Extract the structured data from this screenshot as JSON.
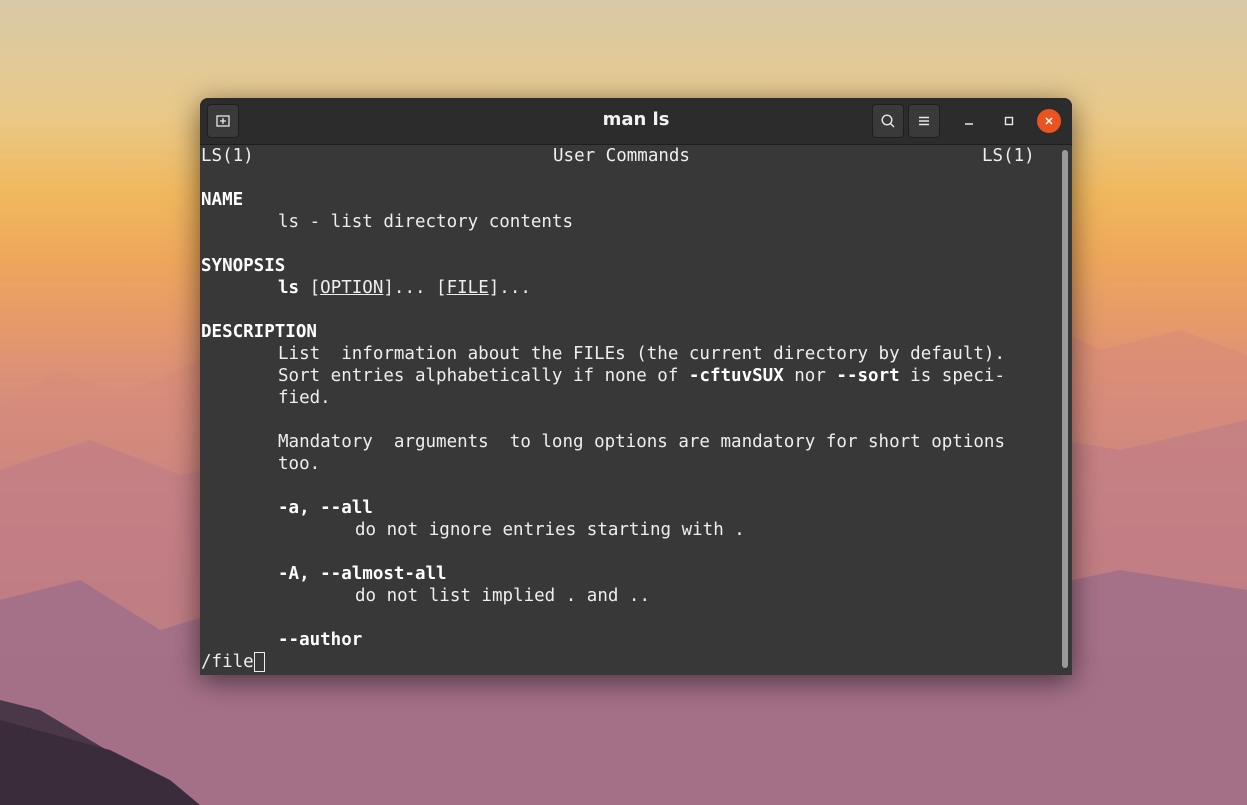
{
  "window": {
    "title": "man ls",
    "controls": [
      "minimize-icon",
      "maximize-icon",
      "close-icon"
    ],
    "accent_close": "#e95420"
  },
  "header": {
    "left": "LS(1)",
    "center": "User Commands",
    "right": "LS(1)"
  },
  "name": {
    "heading": "NAME",
    "text": "ls - list directory contents"
  },
  "synopsis": {
    "heading": "SYNOPSIS",
    "cmd": "ls",
    "open1": " [",
    "option": "OPTION",
    "mid": "]... [",
    "file": "FILE",
    "end": "]..."
  },
  "description": {
    "heading": "DESCRIPTION",
    "l1": "List  information about the FILEs (the current directory by default).",
    "l2a": "Sort entries alphabetically if none of ",
    "l2b": "-cftuvSUX",
    "l2c": " nor ",
    "l2d": "--sort",
    "l2e": " is speci-",
    "l3": "fied.",
    "l4": "Mandatory  arguments  to long options are mandatory for short options",
    "l5": "too."
  },
  "options": [
    {
      "flag": "-a, --all",
      "desc": "do not ignore entries starting with ."
    },
    {
      "flag": "-A, --almost-all",
      "desc": "do not list implied . and .."
    },
    {
      "flag": "--author",
      "desc": ""
    }
  ],
  "prompt": {
    "text": "/file"
  }
}
